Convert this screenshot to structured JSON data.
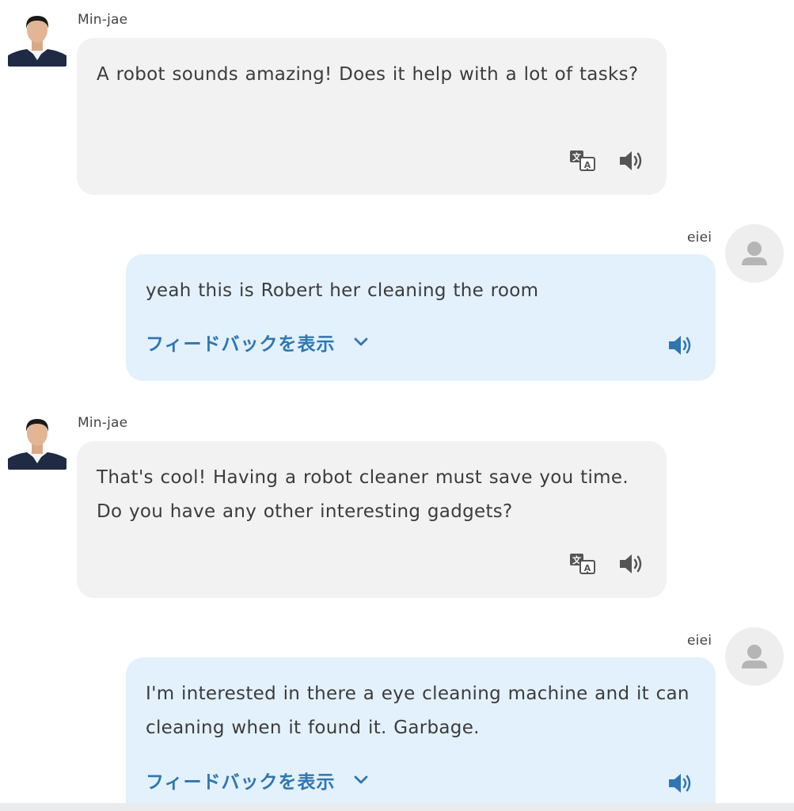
{
  "messages": [
    {
      "sender": "Min-jae",
      "text": "A robot sounds amazing! Does it help with a lot of tasks?"
    },
    {
      "sender": "eiei",
      "text": "yeah this is Robert her cleaning the room",
      "feedback_label": "フィードバックを表示"
    },
    {
      "sender": "Min-jae",
      "text": "That's cool! Having a robot cleaner must save you time. Do you have any other interesting gadgets?"
    },
    {
      "sender": "eiei",
      "text": "I'm interested in there a eye cleaning machine and it can cleaning when it found it. Garbage.",
      "feedback_label": "フィードバックを表示"
    }
  ],
  "icons": {
    "translate": "translate-icon",
    "speaker": "speaker-icon",
    "chevron": "chevron-down-icon",
    "user_avatar": "user-silhouette-icon"
  },
  "colors": {
    "ai_bubble": "#f2f2f2",
    "user_bubble": "#e3f1fc",
    "accent": "#2f76b3",
    "icon_gray": "#555555"
  }
}
